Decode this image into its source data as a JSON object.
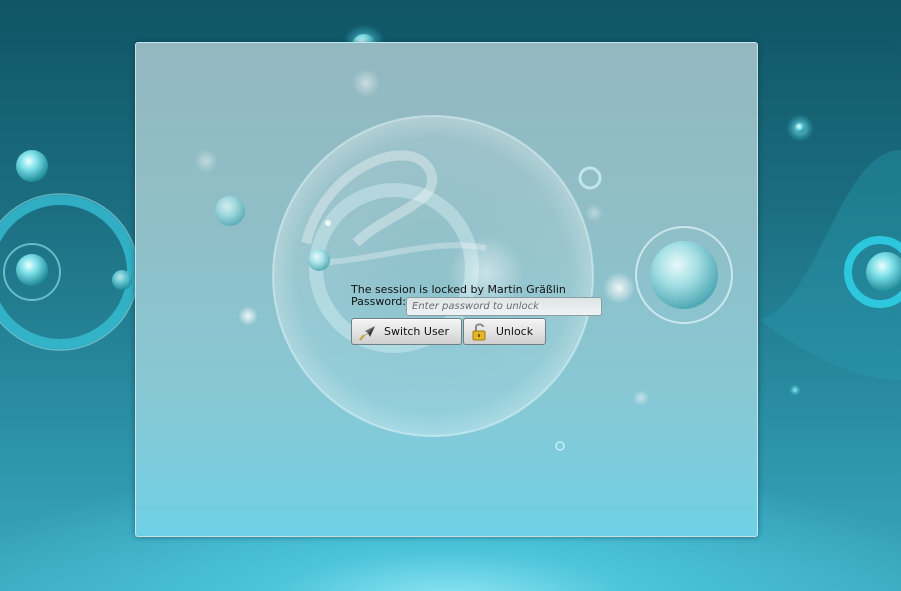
{
  "lock_screen": {
    "message": "The session is locked by Martin Gräßlin",
    "password_label": "Password:",
    "password_placeholder": "Enter password to unlock",
    "password_value": "",
    "switch_user_label": "Switch User",
    "unlock_label": "Unlock"
  },
  "icons": {
    "switch_user": "rocket-icon",
    "unlock": "padlock-open-icon"
  },
  "colors": {
    "accent": "#34d4e8",
    "panel": "#8fbfc8",
    "background": "#1b6e80"
  }
}
